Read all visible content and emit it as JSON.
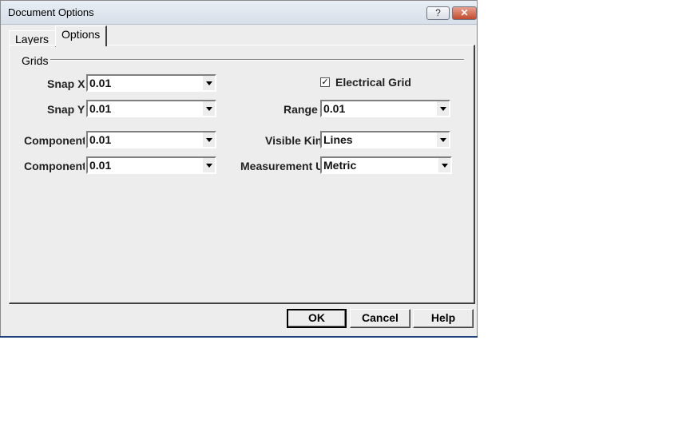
{
  "window": {
    "title": "Document Options",
    "help_glyph": "?",
    "close_glyph": "✕"
  },
  "tabs": [
    {
      "label": "Layers"
    },
    {
      "label": "Options"
    }
  ],
  "grids": {
    "group_label": "Grids",
    "snap_x": {
      "label": "Snap X",
      "value": "0.01"
    },
    "snap_y": {
      "label": "Snap Y",
      "value": "0.01"
    },
    "component_x": {
      "label": "Component X",
      "value": "0.01"
    },
    "component_y": {
      "label": "Component Y",
      "value": "0.01"
    },
    "electrical_grid": {
      "label": "Electrical Grid",
      "checked": true,
      "mark": "✓"
    },
    "range": {
      "label": "Range",
      "value": "0.01"
    },
    "visible_kind": {
      "label": "Visible Kind",
      "value": "Lines"
    },
    "measurement_units": {
      "label": "Measurement Units",
      "value": "Metric"
    }
  },
  "buttons": {
    "ok": "OK",
    "cancel": "Cancel",
    "help": "Help"
  }
}
